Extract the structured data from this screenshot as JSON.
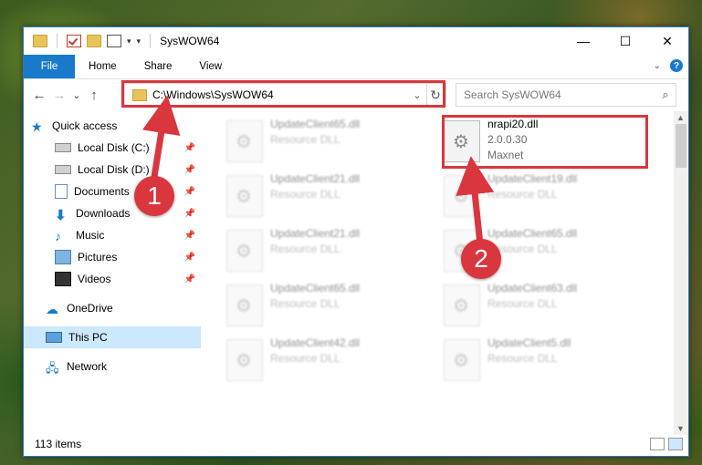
{
  "window": {
    "title": "SysWOW64"
  },
  "titlebar": {
    "minimize": "—",
    "maximize": "☐",
    "close": "✕"
  },
  "ribbon": {
    "tabs": [
      "File",
      "Home",
      "Share",
      "View"
    ],
    "help": "?"
  },
  "nav": {
    "back": "←",
    "forward": "→",
    "recent": "⌄",
    "up": "↑"
  },
  "address": {
    "path": "C:\\Windows\\SysWOW64",
    "chevron": "⌄",
    "refresh": "↻"
  },
  "search": {
    "placeholder": "Search SysWOW64",
    "icon": "⌕"
  },
  "sidebar": {
    "items": [
      {
        "label": "Quick access"
      },
      {
        "label": "Local Disk (C:)"
      },
      {
        "label": "Local Disk (D:)"
      },
      {
        "label": "Documents"
      },
      {
        "label": "Downloads"
      },
      {
        "label": "Music"
      },
      {
        "label": "Pictures"
      },
      {
        "label": "Videos"
      },
      {
        "label": "OneDrive"
      },
      {
        "label": "This PC"
      },
      {
        "label": "Network"
      }
    ]
  },
  "files": [
    {
      "name": "UpdateClient65.dll",
      "sub": "Resource DLL"
    },
    {
      "name": "nrapi20.dll",
      "sub": "2.0.0.30",
      "sub2": "Maxnet"
    },
    {
      "name": "UpdateClient21.dll",
      "sub": "Resource DLL"
    },
    {
      "name": "UpdateClient19.dll",
      "sub": "Resource DLL"
    },
    {
      "name": "UpdateClient21.dll",
      "sub": "Resource DLL"
    },
    {
      "name": "UpdateClient65.dll",
      "sub": "Resource DLL"
    },
    {
      "name": "UpdateClient65.dll",
      "sub": "Resource DLL"
    },
    {
      "name": "UpdateClient63.dll",
      "sub": "Resource DLL"
    },
    {
      "name": "UpdateClient42.dll",
      "sub": "Resource DLL"
    },
    {
      "name": "UpdateClient5.dll",
      "sub": "Resource DLL"
    }
  ],
  "status": {
    "count": "113 items"
  },
  "badges": [
    "1",
    "2"
  ],
  "colors": {
    "accent": "#1979ca",
    "highlight": "#d9363e",
    "selected": "#cce8ff"
  }
}
